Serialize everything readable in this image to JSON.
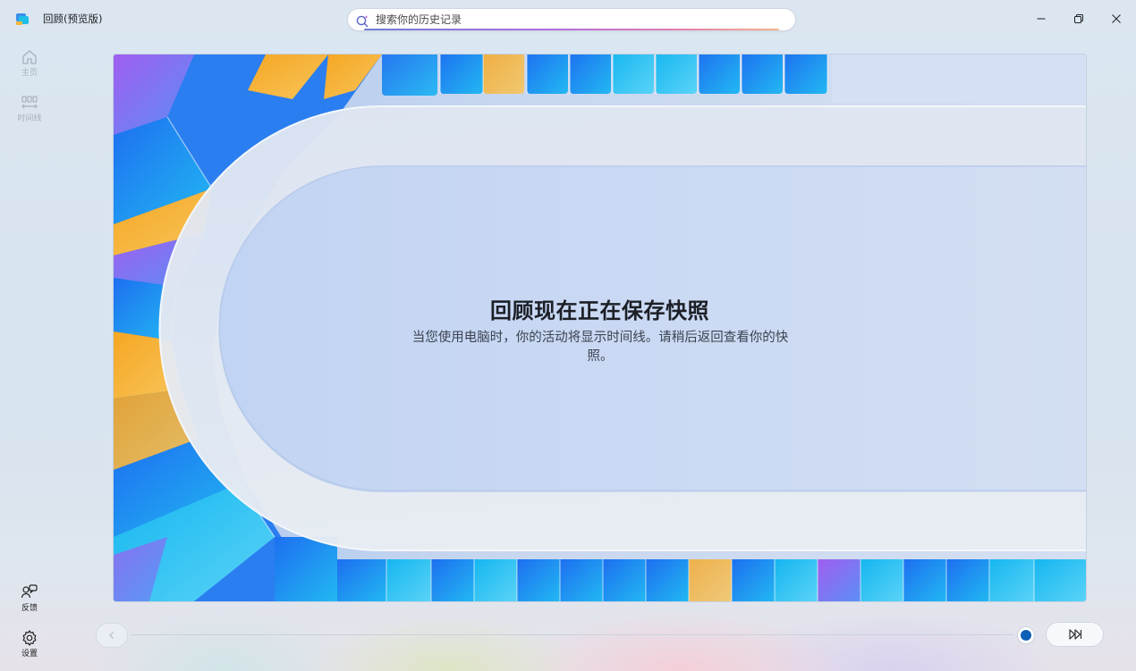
{
  "window": {
    "title": "回顾(预览版)"
  },
  "search": {
    "placeholder": "搜索你的历史记录",
    "value": ""
  },
  "sidebar": {
    "items": [
      {
        "label": "主页",
        "icon": "home-icon",
        "enabled": false
      },
      {
        "label": "时间线",
        "icon": "timeline-icon",
        "enabled": false
      }
    ],
    "bottom_items": [
      {
        "label": "反馈",
        "icon": "feedback-icon"
      },
      {
        "label": "设置",
        "icon": "settings-icon"
      }
    ]
  },
  "main": {
    "title": "回顾现在正在保存快照",
    "description": "当您使用电脑时，你的活动将显示时间线。请稍后返回查看你的快照。"
  },
  "timeline": {
    "prev_icon": "chevron-left-icon",
    "live_icon": "skip-forward-icon",
    "position": 1.0
  },
  "colors": {
    "accent": "#0f5fb6",
    "search_gradient": [
      "#6f7fd9",
      "#b16ee0",
      "#e37fb0",
      "#f3b38d"
    ]
  }
}
